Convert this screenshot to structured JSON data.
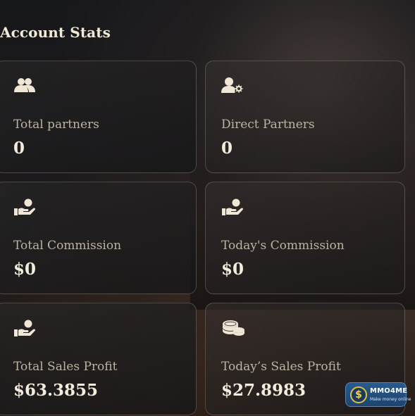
{
  "section": {
    "title": "Account Stats"
  },
  "cards": [
    {
      "icon": "users-icon",
      "label": "Total partners",
      "value": "0"
    },
    {
      "icon": "user-settings-icon",
      "label": "Direct Partners",
      "value": "0"
    },
    {
      "icon": "hand-coin-icon",
      "label": "Total Commission",
      "value": "$0"
    },
    {
      "icon": "hand-coin-icon",
      "label": "Today's Commission",
      "value": "$0"
    },
    {
      "icon": "hand-coin-icon",
      "label": "Total Sales Profit",
      "value": "$63.3855"
    },
    {
      "icon": "coins-stack-icon",
      "label": "Today’s Sales Profit",
      "value": "$27.8983"
    }
  ],
  "watermark": {
    "symbol": "$",
    "name": "MMO4ME",
    "tagline": "Make money online"
  },
  "colors": {
    "icon": "#efe6d6",
    "label": "#bdb3a3",
    "value": "#f3ebdc"
  }
}
